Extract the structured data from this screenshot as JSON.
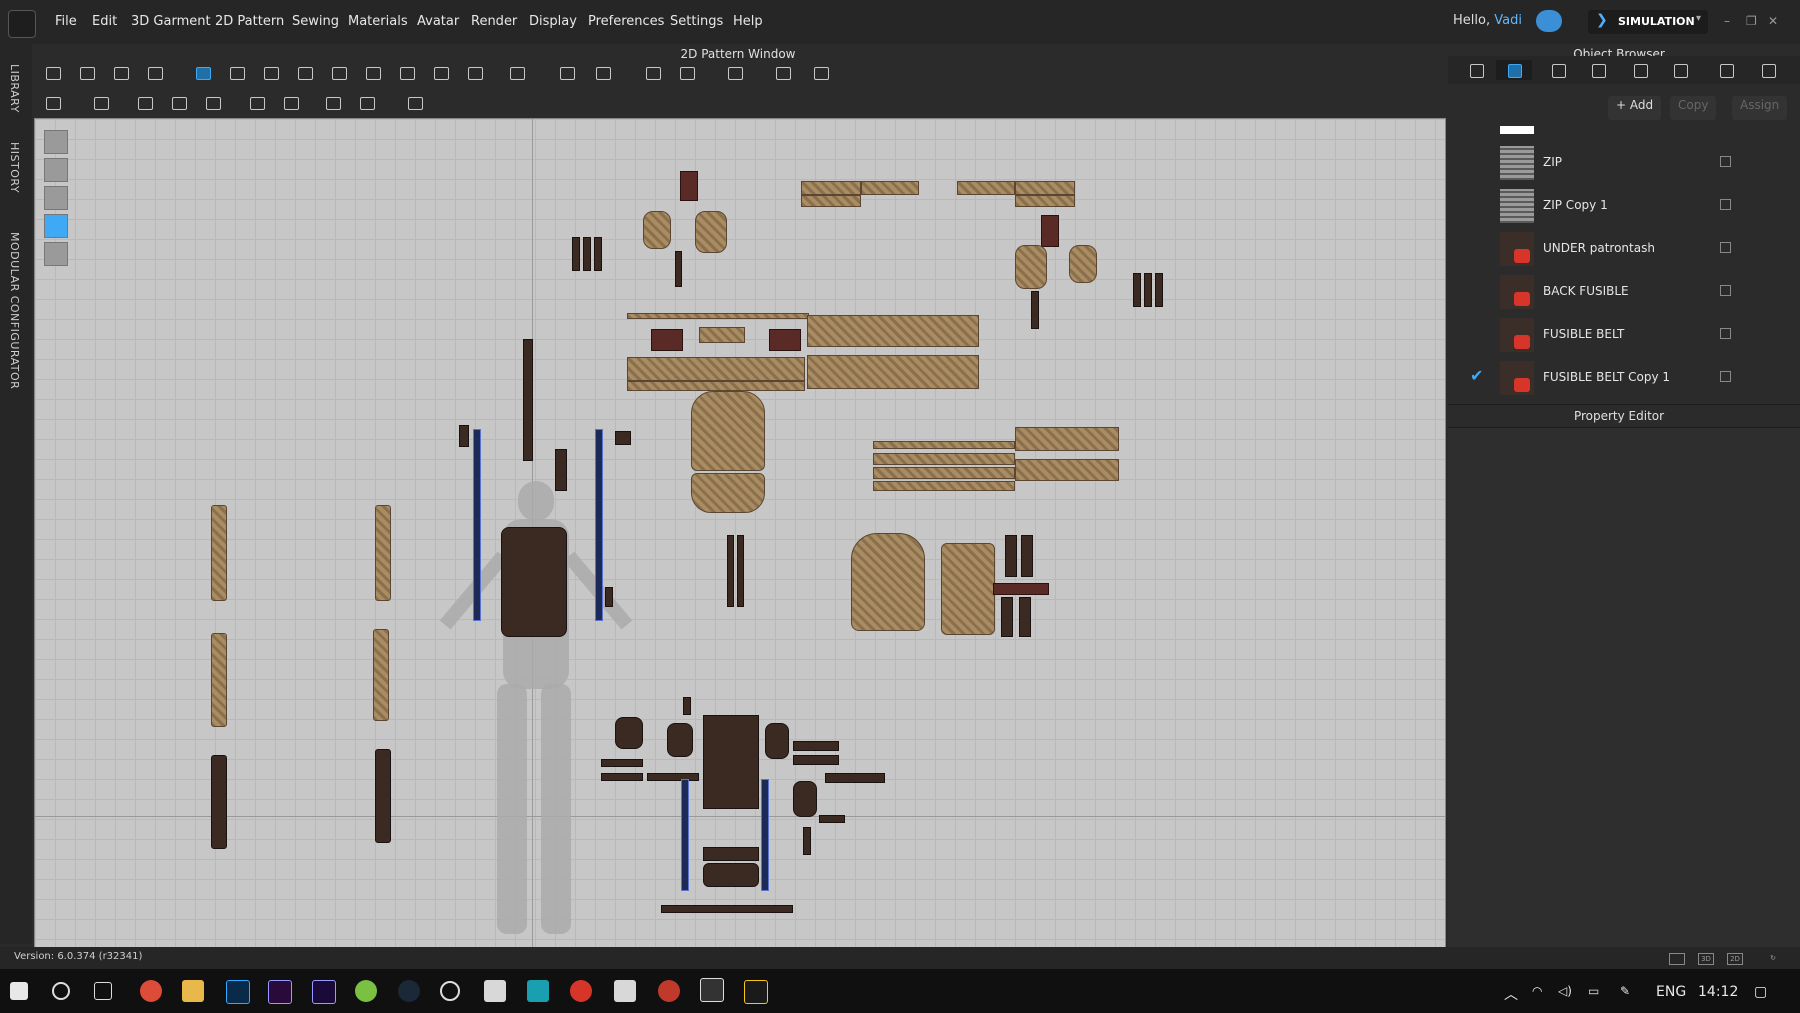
{
  "menu": {
    "items": [
      "File",
      "Edit",
      "3D Garment",
      "2D Pattern",
      "Sewing",
      "Materials",
      "Avatar",
      "Render",
      "Display",
      "Preferences",
      "Settings",
      "Help"
    ],
    "hello_prefix": "Hello,",
    "user": "Vadi",
    "mode": "SIMULATION"
  },
  "side_tabs": [
    "LIBRARY",
    "HISTORY",
    "MODULAR CONFIGURATOR"
  ],
  "pattern_window": {
    "title": "2D Pattern Window"
  },
  "object_browser": {
    "title": "Object Browser",
    "actions": {
      "add": "+ Add",
      "copy": "Copy",
      "assign": "Assign"
    },
    "items": [
      {
        "label": "ZIP",
        "thumb": "zip-icon",
        "checked": false
      },
      {
        "label": "ZIP Copy 1",
        "thumb": "zip-icon",
        "checked": false
      },
      {
        "label": "UNDER patrontash",
        "thumb": "fabric-icon",
        "checked": false
      },
      {
        "label": "BACK FUSIBLE",
        "thumb": "fabric-icon",
        "checked": false
      },
      {
        "label": "FUSIBLE BELT",
        "thumb": "fabric-icon",
        "checked": false
      },
      {
        "label": "FUSIBLE BELT Copy 1",
        "thumb": "fabric-icon",
        "checked": true
      }
    ]
  },
  "property_editor": {
    "title": "Property Editor"
  },
  "status": {
    "version": "Version: 6.0.374 (r32341)"
  },
  "taskbar": {
    "language": "ENG",
    "time": "14:12"
  },
  "colors": {
    "accent": "#3fa9f5",
    "fabric_tan": "#a98c62",
    "fabric_dark": "#3a2a22",
    "canvas": "#c7c7c7"
  }
}
